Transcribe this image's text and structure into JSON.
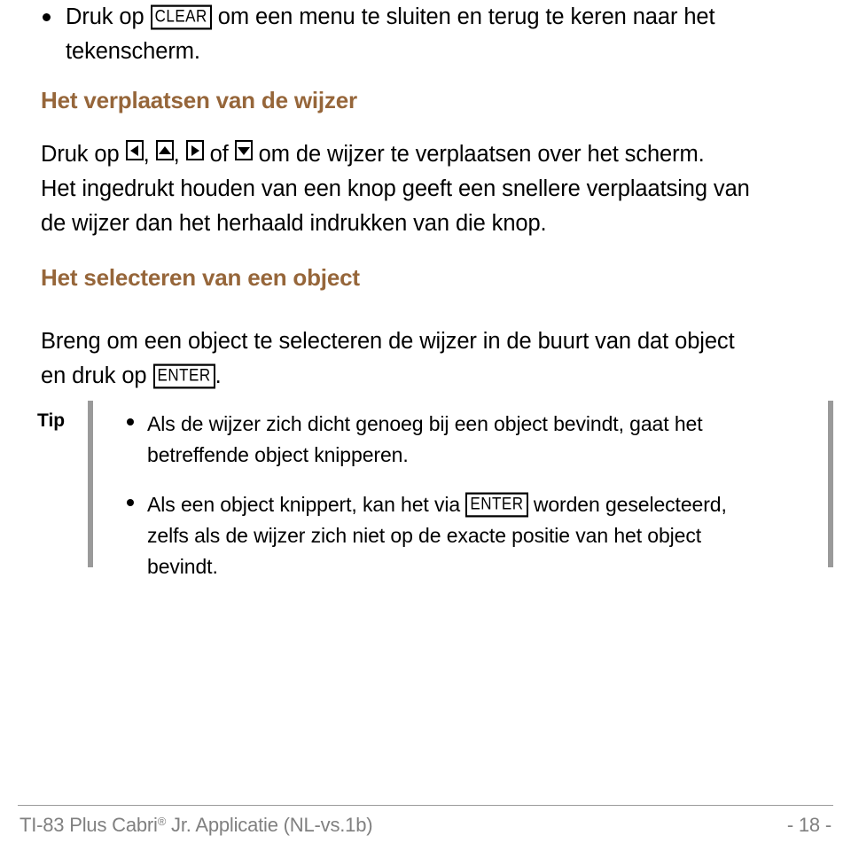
{
  "document": {
    "language": "nl",
    "heading_color": "#96663a",
    "footer_color": "#808080",
    "tip_rule_color": "#9a9a9a"
  },
  "intro_bullet": {
    "before_key": "Druk op",
    "key": "CLEAR",
    "after_key": "om een menu te sluiten en terug te keren naar het",
    "line2": "tekenscherm."
  },
  "section_cursor": {
    "heading": "Het verplaatsen van de wijzer",
    "para_before_keys": "Druk op",
    "key_left": "left-arrow",
    "key_up": "up-arrow",
    "key_right": "right-arrow",
    "key_down": "down-arrow",
    "sep_comma": ",",
    "sep_of": "of",
    "para_after_keys": "om de wijzer te verplaatsen over het scherm.",
    "para_line2": "Het ingedrukt houden van een knop geeft een snellere verplaatsing van",
    "para_line3": "de wijzer dan het herhaald indrukken van die knop."
  },
  "section_select": {
    "heading": "Het selecteren van een object",
    "para_line1": "Breng om een object te selecteren de wijzer in de buurt van dat object",
    "para_line2_before": "en druk op",
    "para_line2_key": "ENTER",
    "para_line2_after": "."
  },
  "tip": {
    "label": "Tip",
    "bullets": [
      {
        "line1": "Als de wijzer zich dicht genoeg bij een object bevindt, gaat het",
        "line2": "betreffende object knipperen."
      },
      {
        "line1_before_key": "Als een object knippert, kan het via",
        "key": "ENTER",
        "line1_after_key": "worden geselecteerd,",
        "line2": "zelfs als de wijzer zich niet op de exacte positie van het object",
        "line3": "bevindt."
      }
    ]
  },
  "footer": {
    "left_part1": "TI-83 Plus Cabri",
    "registered_mark": "®",
    "left_part2": " Jr. Applicatie (NL-vs.1b)",
    "page_number": "- 18 -"
  }
}
